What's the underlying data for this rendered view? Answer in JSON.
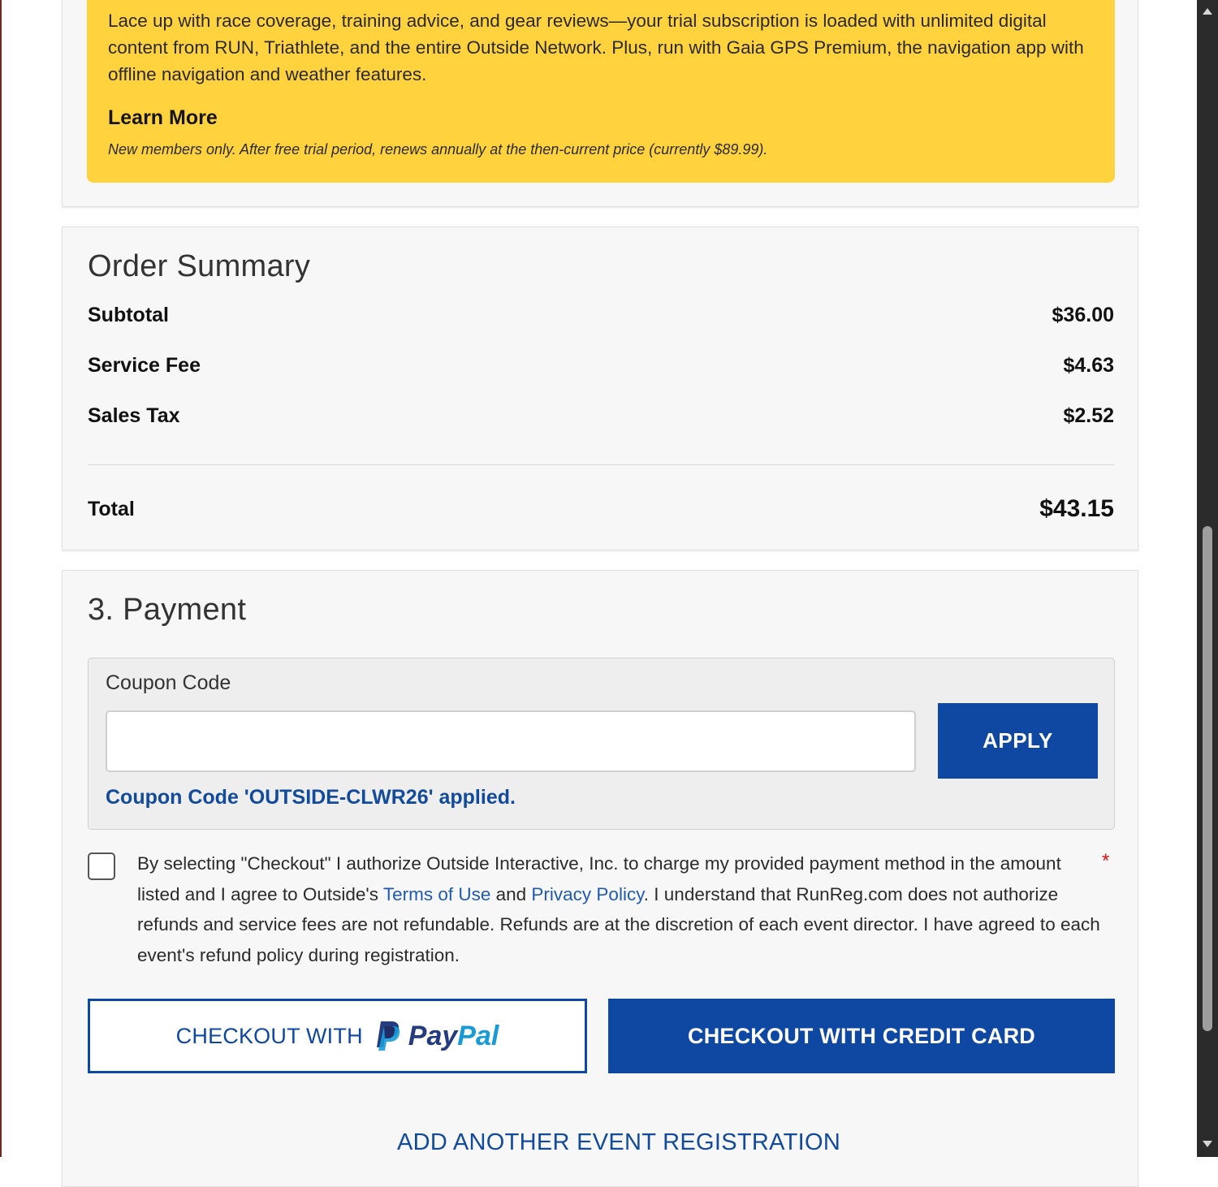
{
  "promo": {
    "description": "Lace up with race coverage, training advice, and gear reviews—your trial subscription is loaded with unlimited digital content from RUN, Triathlete, and the entire Outside Network. Plus, run with Gaia GPS Premium, the navigation app with offline navigation and weather features.",
    "learn_more": "Learn More",
    "note": "New members only. After free trial period, renews annually at the then-current price (currently $89.99)."
  },
  "order_summary": {
    "title": "Order Summary",
    "rows": [
      {
        "label": "Subtotal",
        "value": "$36.00"
      },
      {
        "label": "Service Fee",
        "value": "$4.63"
      },
      {
        "label": "Sales Tax",
        "value": "$2.52"
      }
    ],
    "total_label": "Total",
    "total_value": "$43.15"
  },
  "payment": {
    "title": "3. Payment",
    "coupon_label": "Coupon Code",
    "coupon_value": "",
    "apply_label": "APPLY",
    "coupon_applied": "Coupon Code 'OUTSIDE-CLWR26' applied.",
    "agreement": {
      "part1": "By selecting \"Checkout\" I authorize Outside Interactive, Inc. to charge my provided payment method in the amount listed and I agree to Outside's ",
      "terms_link": "Terms of Use",
      "part2": " and ",
      "privacy_link": "Privacy Policy",
      "part3": ". I understand that RunReg.com does not authorize refunds and service fees are not refundable. Refunds are at the discretion of each event director. I have agreed to each event's refund policy during registration.",
      "required_mark": "*",
      "checked": false
    },
    "paypal_prefix": "CHECKOUT WITH",
    "paypal_brand_pay": "Pay",
    "paypal_brand_pal": "Pal",
    "credit_card_label": "CHECKOUT WITH CREDIT CARD",
    "add_event_label": "ADD ANOTHER EVENT REGISTRATION"
  },
  "colors": {
    "brand_blue": "#0f48a2",
    "promo_yellow": "#ffd23e",
    "link_blue": "#1f5bb3",
    "paypal_dark": "#253b80",
    "paypal_light": "#179bd7"
  }
}
